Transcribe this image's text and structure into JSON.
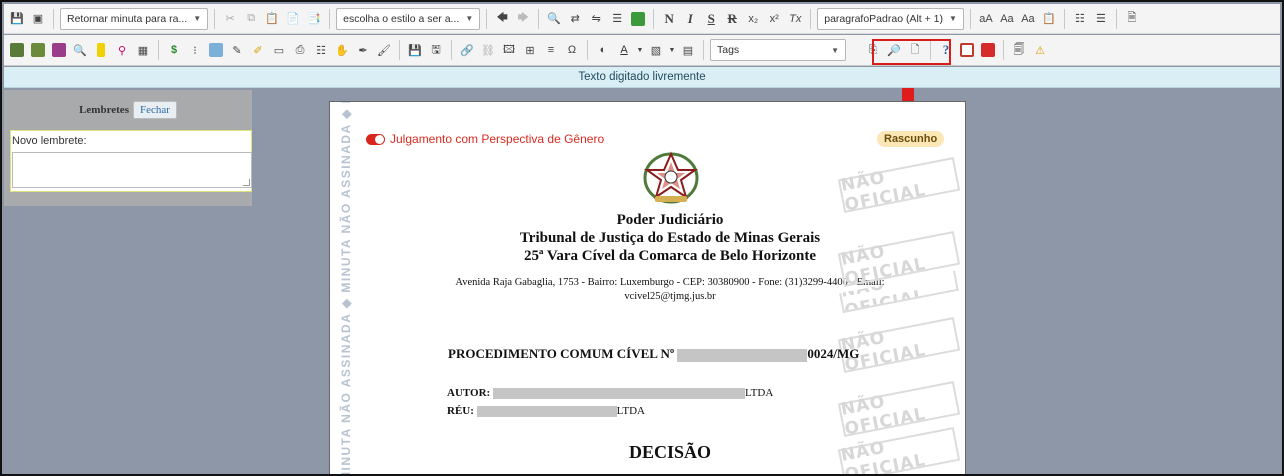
{
  "toolbar1": {
    "return_combo": "Retornar minuta para ra...",
    "style_combo": "escolha o estilo a ser a...",
    "bold": "N",
    "italic": "I",
    "underline": "S",
    "strike": "R",
    "subscript": "x₂",
    "superscript": "x²",
    "clear_format": "Tx",
    "paragraph_combo": "paragrafoPadrao (Alt + 1)",
    "font_grow": "aA",
    "font_shrink": "Aa",
    "case": "Aa"
  },
  "toolbar2": {
    "tags_combo": "Tags",
    "help": "?",
    "omega": "Ω"
  },
  "mode_bar": {
    "text": "Texto digitado livremente"
  },
  "reminders": {
    "title": "Lembretes",
    "close": "Fechar",
    "new_label": "Novo lembrete:"
  },
  "document": {
    "side_watermark": "MINUTA NÃO ASSINADA ◆ MINUTA NÃO ASSINADA ◆ MINUTA NÃO ASSINADA",
    "toggle_label": "Julgamento com Perspectiva de Gênero",
    "draft_badge": "Rascunho",
    "stamp": "NÃO OFICIAL",
    "header_line1": "Poder Judiciário",
    "header_line2": "Tribunal de Justiça do Estado de Minas Gerais",
    "header_line3": "25ª Vara Cível da Comarca de Belo Horizonte",
    "address_line1": "Avenida Raja Gabaglia, 1753 - Bairro: Luxemburgo - CEP: 30380900 - Fone: (31)3299-4400 - Email:",
    "address_line2": "vcivel25@tjmg.jus.br",
    "proc_prefix": "PROCEDIMENTO COMUM CÍVEL Nº",
    "proc_suffix": "0024/MG",
    "autor_label": "AUTOR:",
    "autor_suffix": "LTDA",
    "reu_label": "RÉU:",
    "reu_suffix": "LTDA",
    "decision_title": "DECISÃO"
  },
  "colors": {
    "highlight": "#d91d1d",
    "toggle": "#d9261c",
    "background": "#8d97a7"
  }
}
